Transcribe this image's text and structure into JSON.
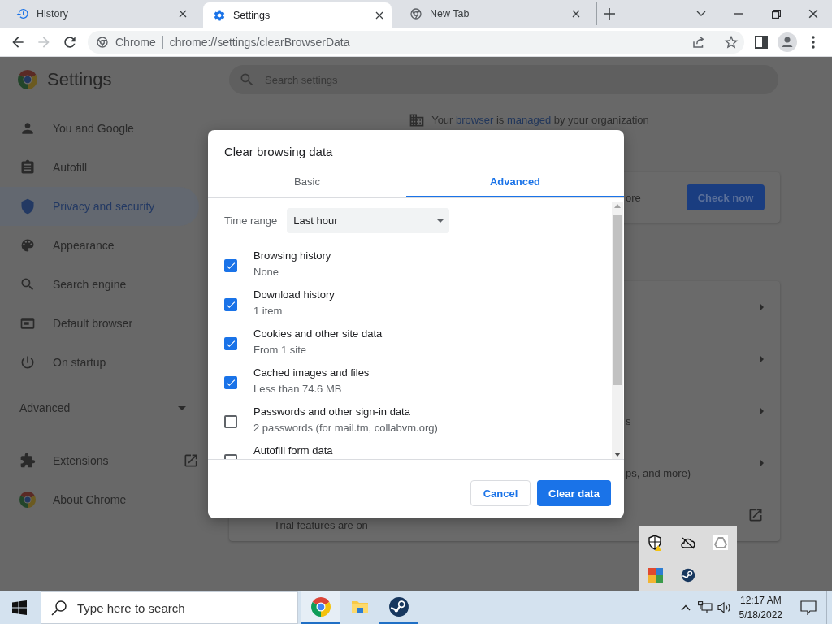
{
  "browser": {
    "tabs": [
      {
        "title": "History",
        "selected": false,
        "kind": "history"
      },
      {
        "title": "Settings",
        "selected": true,
        "kind": "settings"
      },
      {
        "title": "New Tab",
        "selected": false,
        "kind": "chrome"
      }
    ],
    "forward_enabled": false,
    "omnibox": {
      "chip": "Chrome",
      "url": "chrome://settings/clearBrowserData"
    }
  },
  "settings": {
    "title": "Settings",
    "search_placeholder": "Search settings",
    "sidebar": [
      {
        "label": "You and Google",
        "kind": "item",
        "selected": false
      },
      {
        "label": "Autofill",
        "kind": "item",
        "selected": false
      },
      {
        "label": "Privacy and security",
        "kind": "item",
        "selected": true
      },
      {
        "label": "Appearance",
        "kind": "item",
        "selected": false
      },
      {
        "label": "Search engine",
        "kind": "item",
        "selected": false
      },
      {
        "label": "Default browser",
        "kind": "item",
        "selected": false
      },
      {
        "label": "On startup",
        "kind": "item",
        "selected": false
      },
      {
        "label": "Advanced",
        "kind": "section",
        "selected": false
      },
      {
        "label": "Extensions",
        "kind": "external",
        "selected": false
      },
      {
        "label": "About Chrome",
        "kind": "item",
        "selected": false
      }
    ],
    "managed_notice": [
      {
        "text": "Your ",
        "kind": "text"
      },
      {
        "text": "browser",
        "kind": "link"
      },
      {
        "text": " is ",
        "kind": "text"
      },
      {
        "text": "managed",
        "kind": "link"
      },
      {
        "text": " by your organization",
        "kind": "text"
      }
    ],
    "safety_card": {
      "text": "ore",
      "partial": true,
      "button": "Check now"
    },
    "privacy_rows": [
      {
        "kind": "arrow"
      },
      {
        "kind": "arrow"
      },
      {
        "kind": "arrow",
        "subtitle": "s",
        "partial": true
      },
      {
        "kind": "arrow",
        "subtitle": "ps, and more)",
        "partial": true
      },
      {
        "kind": "external",
        "subtitle": "Trial features are on",
        "partial": false
      }
    ]
  },
  "dialog": {
    "title": "Clear browsing data",
    "tabs": [
      {
        "label": "Basic",
        "selected": false
      },
      {
        "label": "Advanced",
        "selected": true
      }
    ],
    "time_range": {
      "label": "Time range",
      "value": "Last hour"
    },
    "items": [
      {
        "title": "Browsing history",
        "subtitle": "None",
        "checked": true
      },
      {
        "title": "Download history",
        "subtitle": "1 item",
        "checked": true
      },
      {
        "title": "Cookies and other site data",
        "subtitle": "From 1 site",
        "checked": true
      },
      {
        "title": "Cached images and files",
        "subtitle": "Less than 74.6 MB",
        "checked": true
      },
      {
        "title": "Passwords and other sign-in data",
        "subtitle": "2 passwords (for mail.tm, collabvm.org)",
        "checked": false
      },
      {
        "title": "Autofill form data",
        "checked": false
      }
    ],
    "buttons": [
      {
        "label": "Cancel",
        "kind": "secondary"
      },
      {
        "label": "Clear data",
        "kind": "primary"
      }
    ]
  },
  "taskbar": {
    "search_placeholder": "Type here to search",
    "apps": [
      {
        "kind": "chrome",
        "running": true,
        "selected": true
      },
      {
        "kind": "folder",
        "running": false,
        "selected": false
      },
      {
        "kind": "steam",
        "running": true,
        "selected": false
      }
    ],
    "time": "12:17 AM",
    "date": "5/18/2022"
  }
}
